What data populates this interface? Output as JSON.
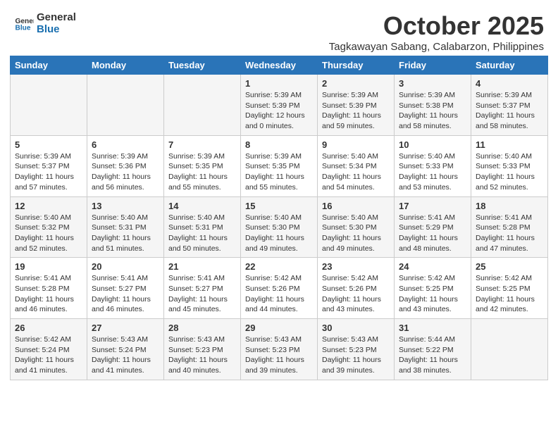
{
  "header": {
    "logo_line1": "General",
    "logo_line2": "Blue",
    "month_year": "October 2025",
    "location": "Tagkawayan Sabang, Calabarzon, Philippines"
  },
  "weekdays": [
    "Sunday",
    "Monday",
    "Tuesday",
    "Wednesday",
    "Thursday",
    "Friday",
    "Saturday"
  ],
  "weeks": [
    [
      {
        "day": "",
        "info": ""
      },
      {
        "day": "",
        "info": ""
      },
      {
        "day": "",
        "info": ""
      },
      {
        "day": "1",
        "info": "Sunrise: 5:39 AM\nSunset: 5:39 PM\nDaylight: 12 hours\nand 0 minutes."
      },
      {
        "day": "2",
        "info": "Sunrise: 5:39 AM\nSunset: 5:39 PM\nDaylight: 11 hours\nand 59 minutes."
      },
      {
        "day": "3",
        "info": "Sunrise: 5:39 AM\nSunset: 5:38 PM\nDaylight: 11 hours\nand 58 minutes."
      },
      {
        "day": "4",
        "info": "Sunrise: 5:39 AM\nSunset: 5:37 PM\nDaylight: 11 hours\nand 58 minutes."
      }
    ],
    [
      {
        "day": "5",
        "info": "Sunrise: 5:39 AM\nSunset: 5:37 PM\nDaylight: 11 hours\nand 57 minutes."
      },
      {
        "day": "6",
        "info": "Sunrise: 5:39 AM\nSunset: 5:36 PM\nDaylight: 11 hours\nand 56 minutes."
      },
      {
        "day": "7",
        "info": "Sunrise: 5:39 AM\nSunset: 5:35 PM\nDaylight: 11 hours\nand 55 minutes."
      },
      {
        "day": "8",
        "info": "Sunrise: 5:39 AM\nSunset: 5:35 PM\nDaylight: 11 hours\nand 55 minutes."
      },
      {
        "day": "9",
        "info": "Sunrise: 5:40 AM\nSunset: 5:34 PM\nDaylight: 11 hours\nand 54 minutes."
      },
      {
        "day": "10",
        "info": "Sunrise: 5:40 AM\nSunset: 5:33 PM\nDaylight: 11 hours\nand 53 minutes."
      },
      {
        "day": "11",
        "info": "Sunrise: 5:40 AM\nSunset: 5:33 PM\nDaylight: 11 hours\nand 52 minutes."
      }
    ],
    [
      {
        "day": "12",
        "info": "Sunrise: 5:40 AM\nSunset: 5:32 PM\nDaylight: 11 hours\nand 52 minutes."
      },
      {
        "day": "13",
        "info": "Sunrise: 5:40 AM\nSunset: 5:31 PM\nDaylight: 11 hours\nand 51 minutes."
      },
      {
        "day": "14",
        "info": "Sunrise: 5:40 AM\nSunset: 5:31 PM\nDaylight: 11 hours\nand 50 minutes."
      },
      {
        "day": "15",
        "info": "Sunrise: 5:40 AM\nSunset: 5:30 PM\nDaylight: 11 hours\nand 49 minutes."
      },
      {
        "day": "16",
        "info": "Sunrise: 5:40 AM\nSunset: 5:30 PM\nDaylight: 11 hours\nand 49 minutes."
      },
      {
        "day": "17",
        "info": "Sunrise: 5:41 AM\nSunset: 5:29 PM\nDaylight: 11 hours\nand 48 minutes."
      },
      {
        "day": "18",
        "info": "Sunrise: 5:41 AM\nSunset: 5:28 PM\nDaylight: 11 hours\nand 47 minutes."
      }
    ],
    [
      {
        "day": "19",
        "info": "Sunrise: 5:41 AM\nSunset: 5:28 PM\nDaylight: 11 hours\nand 46 minutes."
      },
      {
        "day": "20",
        "info": "Sunrise: 5:41 AM\nSunset: 5:27 PM\nDaylight: 11 hours\nand 46 minutes."
      },
      {
        "day": "21",
        "info": "Sunrise: 5:41 AM\nSunset: 5:27 PM\nDaylight: 11 hours\nand 45 minutes."
      },
      {
        "day": "22",
        "info": "Sunrise: 5:42 AM\nSunset: 5:26 PM\nDaylight: 11 hours\nand 44 minutes."
      },
      {
        "day": "23",
        "info": "Sunrise: 5:42 AM\nSunset: 5:26 PM\nDaylight: 11 hours\nand 43 minutes."
      },
      {
        "day": "24",
        "info": "Sunrise: 5:42 AM\nSunset: 5:25 PM\nDaylight: 11 hours\nand 43 minutes."
      },
      {
        "day": "25",
        "info": "Sunrise: 5:42 AM\nSunset: 5:25 PM\nDaylight: 11 hours\nand 42 minutes."
      }
    ],
    [
      {
        "day": "26",
        "info": "Sunrise: 5:42 AM\nSunset: 5:24 PM\nDaylight: 11 hours\nand 41 minutes."
      },
      {
        "day": "27",
        "info": "Sunrise: 5:43 AM\nSunset: 5:24 PM\nDaylight: 11 hours\nand 41 minutes."
      },
      {
        "day": "28",
        "info": "Sunrise: 5:43 AM\nSunset: 5:23 PM\nDaylight: 11 hours\nand 40 minutes."
      },
      {
        "day": "29",
        "info": "Sunrise: 5:43 AM\nSunset: 5:23 PM\nDaylight: 11 hours\nand 39 minutes."
      },
      {
        "day": "30",
        "info": "Sunrise: 5:43 AM\nSunset: 5:23 PM\nDaylight: 11 hours\nand 39 minutes."
      },
      {
        "day": "31",
        "info": "Sunrise: 5:44 AM\nSunset: 5:22 PM\nDaylight: 11 hours\nand 38 minutes."
      },
      {
        "day": "",
        "info": ""
      }
    ]
  ]
}
